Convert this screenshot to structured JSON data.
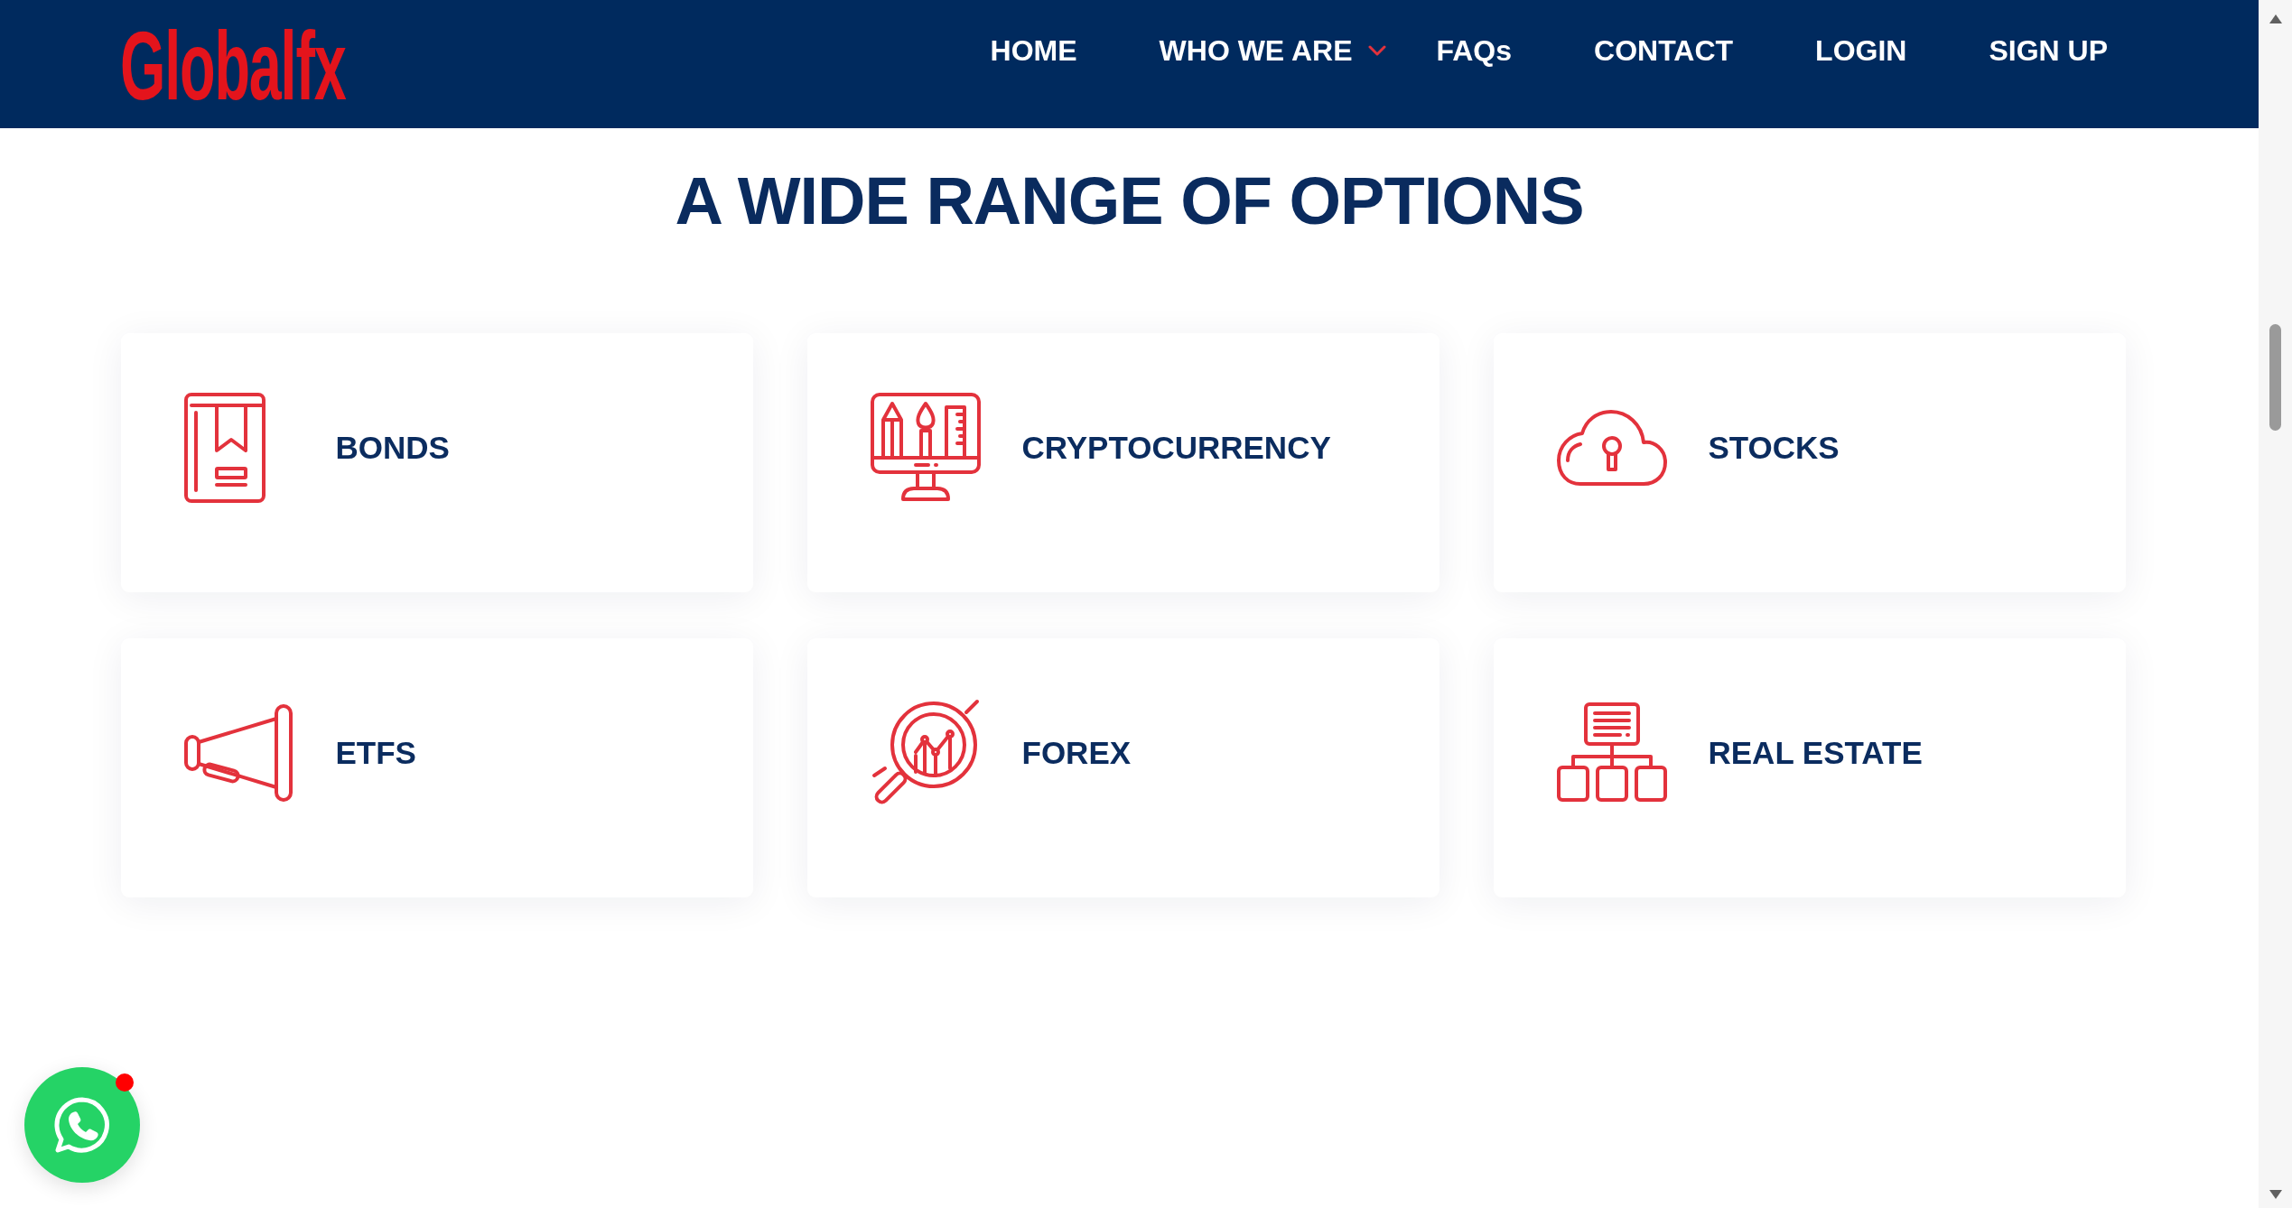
{
  "header": {
    "logo": "Globalfx",
    "nav": [
      {
        "label": "HOME",
        "dropdown": false
      },
      {
        "label": "WHO WE ARE",
        "dropdown": true
      },
      {
        "label": "FAQs",
        "dropdown": false
      },
      {
        "label": "CONTACT",
        "dropdown": false
      },
      {
        "label": "LOGIN",
        "dropdown": false
      },
      {
        "label": "SIGN UP",
        "dropdown": false
      }
    ]
  },
  "options": {
    "title": "A WIDE RANGE OF OPTIONS",
    "cards": [
      {
        "label": "BONDS"
      },
      {
        "label": "CRYPTOCURRENCY"
      },
      {
        "label": "STOCKS"
      },
      {
        "label": "ETFS"
      },
      {
        "label": "FOREX"
      },
      {
        "label": "REAL ESTATE"
      }
    ]
  },
  "chat_button": {
    "notification": true
  }
}
